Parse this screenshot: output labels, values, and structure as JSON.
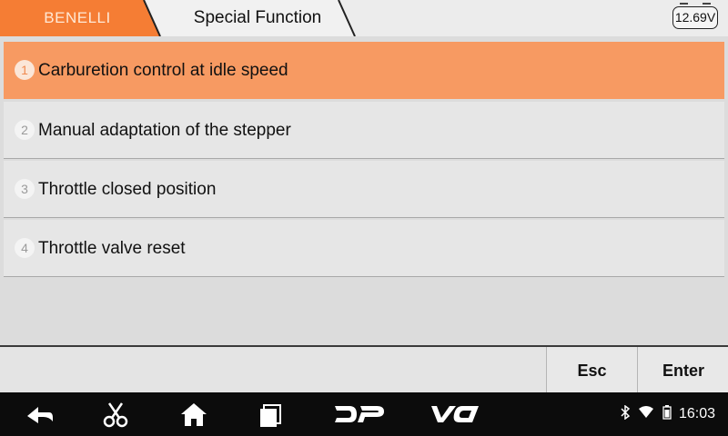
{
  "header": {
    "brand": "BENELLI",
    "title": "Special Function",
    "voltage": "12.69V"
  },
  "colors": {
    "accent": "#f57d34",
    "selected_row": "#f79a62"
  },
  "menu": {
    "items": [
      {
        "number": "1",
        "label": "Carburetion control at idle speed",
        "selected": true
      },
      {
        "number": "2",
        "label": "Manual adaptation of the stepper",
        "selected": false
      },
      {
        "number": "3",
        "label": "Throttle closed position",
        "selected": false
      },
      {
        "number": "4",
        "label": "Throttle valve reset",
        "selected": false
      }
    ]
  },
  "buttons": {
    "esc": "Esc",
    "enter": "Enter"
  },
  "navbar": {
    "icons": [
      "back-icon",
      "scissors-icon",
      "home-icon",
      "recent-apps-icon",
      "dp-icon",
      "vci-icon"
    ],
    "dp_label": "DP",
    "vci_label": "VCI",
    "status_icons": [
      "bluetooth-icon",
      "wifi-icon",
      "battery-icon"
    ],
    "time": "16:03"
  }
}
